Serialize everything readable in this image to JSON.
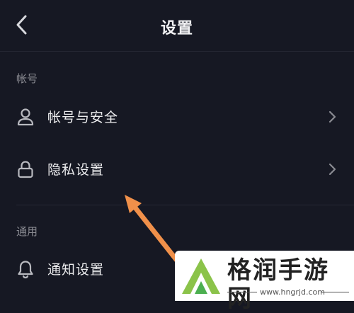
{
  "header": {
    "title": "设置",
    "back_icon": "chevron-left-icon"
  },
  "sections": [
    {
      "label": "帐号",
      "items": [
        {
          "label": "帐号与安全",
          "icon": "user-icon",
          "chevron": "chevron-right-icon"
        },
        {
          "label": "隐私设置",
          "icon": "lock-icon",
          "chevron": "chevron-right-icon"
        }
      ]
    },
    {
      "label": "通用",
      "items": [
        {
          "label": "通知设置",
          "icon": "bell-icon"
        }
      ]
    }
  ],
  "annotation": {
    "type": "arrow",
    "color": "#f0904a"
  },
  "watermark": {
    "name": "格润手游网",
    "url": "www.hngrjd.com",
    "logo": "green-triangle-logo"
  },
  "colors": {
    "background": "#161823",
    "text": "#ececee",
    "muted": "#8a8b92",
    "divider": "#262835"
  }
}
